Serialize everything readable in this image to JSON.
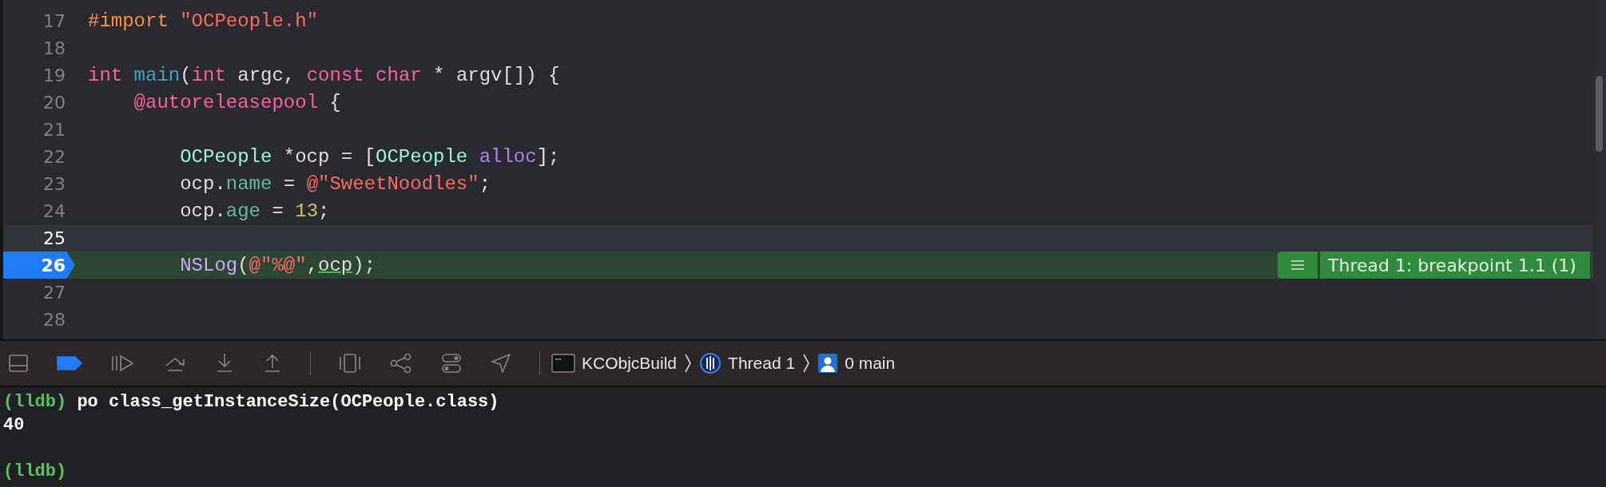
{
  "editor": {
    "lines": [
      {
        "number": "17",
        "current": false,
        "breakpoint": false,
        "tokens": [
          {
            "text": "#import ",
            "kind": "preprocessor"
          },
          {
            "text": "\"OCPeople.h\"",
            "kind": "string"
          }
        ]
      },
      {
        "number": "18",
        "current": false,
        "breakpoint": false
      },
      {
        "number": "19",
        "current": false,
        "breakpoint": false,
        "tokens": [
          {
            "text": "int ",
            "kind": "keyword"
          },
          {
            "text": "main",
            "kind": "declaration"
          },
          {
            "text": "(",
            "kind": "plain"
          },
          {
            "text": "int",
            "kind": "keyword"
          },
          {
            "text": " argc, ",
            "kind": "plain"
          },
          {
            "text": "const ",
            "kind": "keyword"
          },
          {
            "text": "char",
            "kind": "keyword"
          },
          {
            "text": " * argv[]) {",
            "kind": "plain"
          }
        ],
        "children": [
          {
            "number": "20",
            "current": false,
            "breakpoint": false,
            "tokens": [
              {
                "text": "@autoreleasepool",
                "kind": "keyword"
              },
              {
                "text": " {",
                "kind": "plain"
              }
            ],
            "children": [
              {
                "number": "21",
                "current": false,
                "breakpoint": false
              },
              {
                "number": "22",
                "current": false,
                "breakpoint": false,
                "tokens": [
                  {
                    "text": "OCPeople",
                    "kind": "type"
                  },
                  {
                    "text": " *ocp = [",
                    "kind": "plain"
                  },
                  {
                    "text": "OCPeople",
                    "kind": "type"
                  },
                  {
                    "text": " alloc",
                    "kind": "method"
                  },
                  {
                    "text": "];",
                    "kind": "plain"
                  }
                ]
              },
              {
                "number": "23",
                "current": false,
                "breakpoint": false,
                "tokens": [
                  {
                    "text": "ocp.",
                    "kind": "plain"
                  },
                  {
                    "text": "name",
                    "kind": "property"
                  },
                  {
                    "text": " = ",
                    "kind": "plain"
                  },
                  {
                    "text": "@\"SweetNoodles\"",
                    "kind": "string"
                  },
                  {
                    "text": ";",
                    "kind": "plain"
                  }
                ]
              },
              {
                "number": "24",
                "current": false,
                "breakpoint": false,
                "tokens": [
                  {
                    "text": "ocp.",
                    "kind": "plain"
                  },
                  {
                    "text": "age",
                    "kind": "property"
                  },
                  {
                    "text": " = ",
                    "kind": "plain"
                  },
                  {
                    "text": "13",
                    "kind": "number"
                  },
                  {
                    "text": ";",
                    "kind": "plain"
                  }
                ]
              },
              {
                "number": "25",
                "current": true,
                "breakpoint": false
              },
              {
                "number": "26",
                "current": false,
                "breakpoint": true,
                "annotation": "Thread 1: breakpoint 1.1 (1)",
                "tokens": [
                  {
                    "text": "NSLog",
                    "kind": "function"
                  },
                  {
                    "text": "(",
                    "kind": "plain"
                  },
                  {
                    "text": "@\"%@\"",
                    "kind": "string"
                  },
                  {
                    "text": ",",
                    "kind": "plain"
                  },
                  {
                    "text": "ocp",
                    "kind": "underlined"
                  },
                  {
                    "text": ");",
                    "kind": "plain"
                  }
                ]
              },
              {
                "number": "27",
                "current": false,
                "breakpoint": false
              },
              {
                "number": "28",
                "current": false,
                "breakpoint": false
              }
            ]
          }
        ]
      }
    ]
  },
  "debug_bar": {
    "breakpoints_active": true,
    "breadcrumb": [
      {
        "kind": "target",
        "label": "KCObjcBuild"
      },
      {
        "kind": "thread",
        "label": "Thread 1"
      },
      {
        "kind": "frame",
        "label": "0 main"
      }
    ]
  },
  "console": {
    "lines": [
      {
        "kind": "command",
        "prompt": "(lldb)",
        "text": "po class_getInstanceSize(OCPeople.class)"
      },
      {
        "kind": "output",
        "text": "40"
      },
      {
        "kind": "blank"
      },
      {
        "kind": "prompt",
        "prompt": "(lldb)"
      }
    ]
  }
}
